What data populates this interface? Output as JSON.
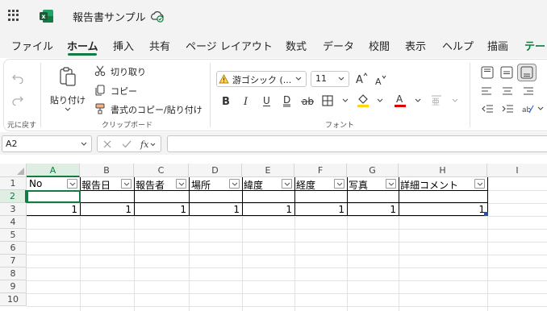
{
  "app": {
    "doc_title": "報告書サンプル"
  },
  "tabs": [
    "ファイル",
    "ホーム",
    "挿入",
    "共有",
    "ページ レイアウト",
    "数式",
    "データ",
    "校閲",
    "表示",
    "ヘルプ",
    "描画",
    "テー"
  ],
  "ribbon": {
    "undo_group_label": "元に戻す",
    "paste_label": "貼り付け",
    "cut_label": "切り取り",
    "copy_label": "コピー",
    "format_painter_label": "書式のコピー/貼り付け",
    "clipboard_group_label": "クリップボード",
    "font_name": "游ゴシック (...",
    "font_size": "11",
    "font_group_label": "フォント"
  },
  "formula_bar": {
    "name_box": "A2",
    "formula": ""
  },
  "sheet": {
    "columns": [
      "A",
      "B",
      "C",
      "D",
      "E",
      "F",
      "G",
      "H",
      "I"
    ],
    "rows": [
      "1",
      "2",
      "3",
      "4",
      "5",
      "6",
      "7",
      "8",
      "9",
      "10"
    ],
    "headers": [
      "No",
      "報告日",
      "報告者",
      "場所",
      "緯度",
      "経度",
      "写真",
      "詳細コメント"
    ],
    "row3": [
      "1",
      "1",
      "1",
      "1",
      "1",
      "1",
      "1",
      "1"
    ],
    "active_cell": "A2"
  },
  "colors": {
    "accent": "#107c41",
    "font_color_bar": "#e00000",
    "highlight_bar": "#ffd800"
  }
}
